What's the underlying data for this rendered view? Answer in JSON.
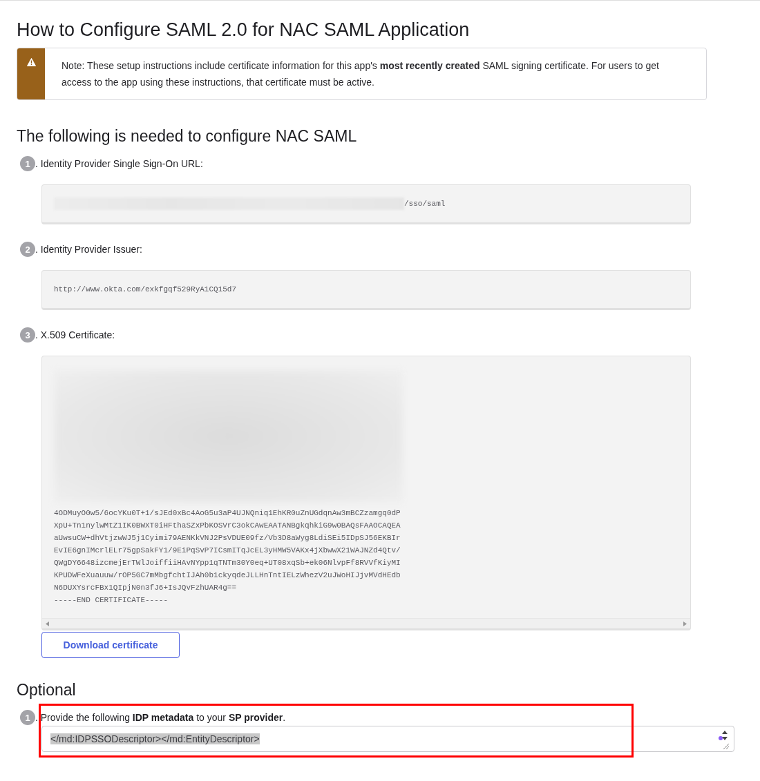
{
  "title": "How to Configure SAML 2.0 for NAC SAML Application",
  "note": {
    "text": "Note: These setup instructions include certificate information for this app's **most recently created** SAML signing certificate. For users to get access to the app using these instructions, that certificate must be active."
  },
  "config": {
    "heading": "The following is needed to configure NAC SAML",
    "steps": [
      {
        "number": "1",
        "label": ". Identity Provider Single Sign-On URL:",
        "kind": "url",
        "value": "/sso/saml",
        "redacted": true
      },
      {
        "number": "2",
        "label": ". Identity Provider Issuer:",
        "kind": "url",
        "value": "http://www.okta.com/exkfgqf529RyA1CQ15d7"
      },
      {
        "number": "3",
        "label": ". X.509 Certificate:",
        "kind": "certificate",
        "redacted": true,
        "lines": [
          "4ODMuyO0w5/6ocYKu0T+1/sJEd0xBc4AoG5u3aP4UJNQniq1EhKR0uZnUGdqnAw3mBCZzamgq0dP",
          "XpU+Tn1nylwMtZ1IK0BWXT0iHFthaSZxPbKOSVrC3okCAwEAATANBgkqhkiG9w0BAQsFAAOCAQEA",
          "aUwsuCW+dhVtjzwWJ5j1Cyimi79AENKkVNJ2PsVDUE09fz/Vb3D8aWyg8LdiSEi5IDpSJ56EKBIr",
          "EvIE6gnIMcrlELr75gpSakFY1/9EiPqSvP7ICsmITqJcEL3yHMW5VAKx4jXbwwX21WAJNZd4Qtv/",
          "QWgDY6648izcmejErTWlJoiffiiHAvNYpp1qTNTm30Y0eq+UT08xqSb+ek06NlvpFf8RVVfKiyMI",
          "KPUDWFeXuauuw/rOP5GC7mMbgfchtIJAh0b1ckyqdeJLLHnTntIELzWhezV2uJWoHIJjvMVdHEdb",
          "N6DUXYsrcFBx1QIpjN0n3fJ6+IsJQvFzhUAR4g==",
          "-----END CERTIFICATE-----"
        ],
        "button": "Download certificate"
      }
    ]
  },
  "optional": {
    "heading": "Optional",
    "steps": [
      {
        "number": "1",
        "label": ". Provide the following **IDP metadata** to your **SP provider**.",
        "kind": "metadata",
        "value": "</md:IDPSSODescriptor></md:EntityDescriptor>",
        "highlighted": true
      }
    ]
  }
}
